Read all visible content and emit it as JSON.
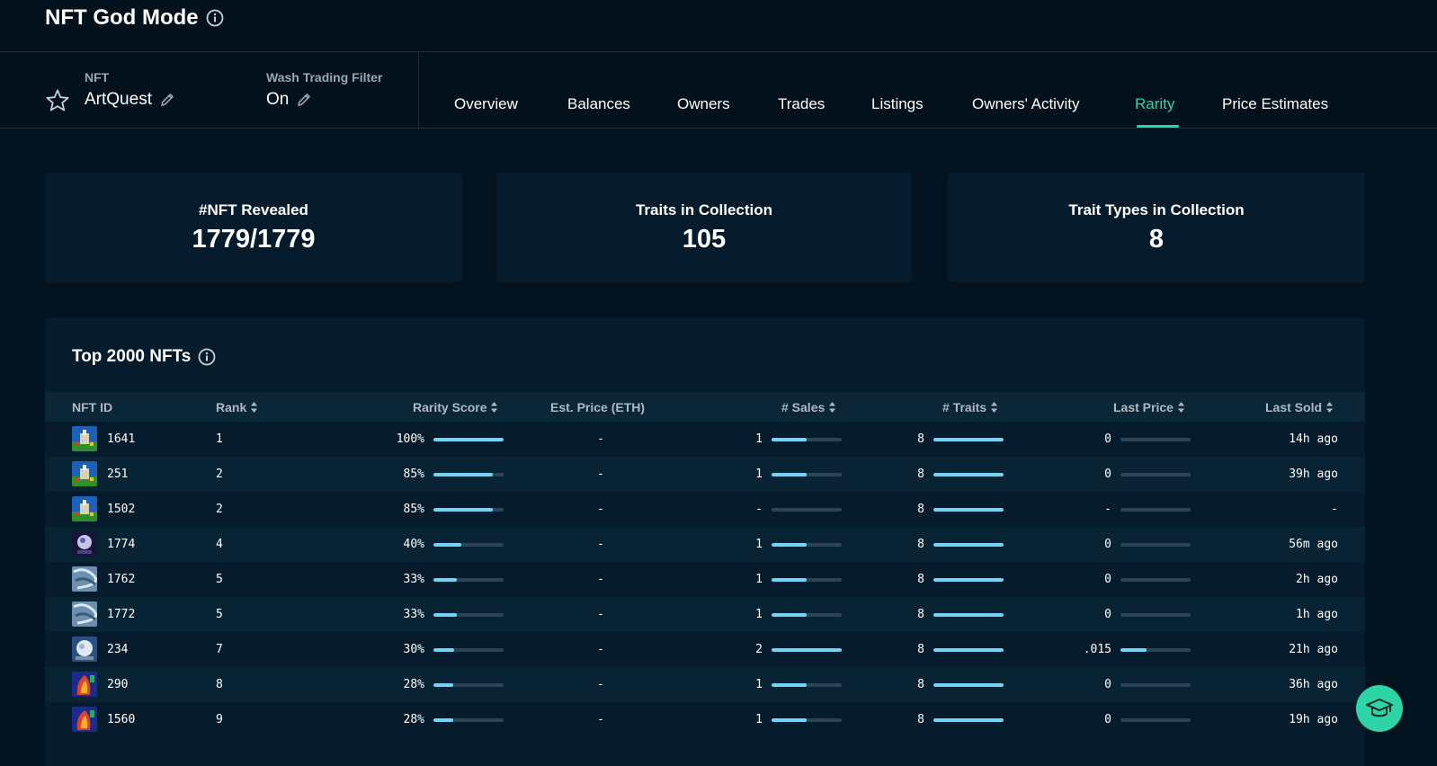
{
  "header": {
    "title": "NFT God Mode"
  },
  "filters": {
    "nft_label": "NFT",
    "nft_value": "ArtQuest",
    "wash_label": "Wash Trading Filter",
    "wash_value": "On"
  },
  "tabs": [
    {
      "label": "Overview"
    },
    {
      "label": "Balances"
    },
    {
      "label": "Owners"
    },
    {
      "label": "Trades"
    },
    {
      "label": "Listings"
    },
    {
      "label": "Owners' Activity"
    },
    {
      "label": "Rarity",
      "active": true
    },
    {
      "label": "Price Estimates"
    }
  ],
  "stats": [
    {
      "title": "#NFT Revealed",
      "value": "1779/1779"
    },
    {
      "title": "Traits in Collection",
      "value": "105"
    },
    {
      "title": "Trait Types in Collection",
      "value": "8"
    }
  ],
  "table": {
    "title": "Top 2000 NFTs",
    "columns": [
      "NFT ID",
      "Rank",
      "Rarity Score",
      "Est. Price (ETH)",
      "# Sales",
      "# Traits",
      "Last Price",
      "Last Sold"
    ],
    "rows": [
      {
        "id": "1641",
        "rank": "1",
        "rarity": "100%",
        "rarity_frac": 1.0,
        "est": "-",
        "sales": "1",
        "sales_frac": 0.5,
        "traits": "8",
        "traits_frac": 1.0,
        "last_price": "0",
        "price_frac": 0,
        "last_sold": "14h ago",
        "thumb": "castle"
      },
      {
        "id": "251",
        "rank": "2",
        "rarity": "85%",
        "rarity_frac": 0.85,
        "est": "-",
        "sales": "1",
        "sales_frac": 0.5,
        "traits": "8",
        "traits_frac": 1.0,
        "last_price": "0",
        "price_frac": 0,
        "last_sold": "39h ago",
        "thumb": "castle"
      },
      {
        "id": "1502",
        "rank": "2",
        "rarity": "85%",
        "rarity_frac": 0.85,
        "est": "-",
        "sales": "-",
        "sales_frac": 0,
        "traits": "8",
        "traits_frac": 1.0,
        "last_price": "-",
        "price_frac": 0,
        "last_sold": "-",
        "thumb": "castle"
      },
      {
        "id": "1774",
        "rank": "4",
        "rarity": "40%",
        "rarity_frac": 0.4,
        "est": "-",
        "sales": "1",
        "sales_frac": 0.5,
        "traits": "8",
        "traits_frac": 1.0,
        "last_price": "0",
        "price_frac": 0,
        "last_sold": "56m ago",
        "thumb": "orb"
      },
      {
        "id": "1762",
        "rank": "5",
        "rarity": "33%",
        "rarity_frac": 0.33,
        "est": "-",
        "sales": "1",
        "sales_frac": 0.5,
        "traits": "8",
        "traits_frac": 1.0,
        "last_price": "0",
        "price_frac": 0,
        "last_sold": "2h ago",
        "thumb": "swirl"
      },
      {
        "id": "1772",
        "rank": "5",
        "rarity": "33%",
        "rarity_frac": 0.33,
        "est": "-",
        "sales": "1",
        "sales_frac": 0.5,
        "traits": "8",
        "traits_frac": 1.0,
        "last_price": "0",
        "price_frac": 0,
        "last_sold": "1h ago",
        "thumb": "swirl"
      },
      {
        "id": "234",
        "rank": "7",
        "rarity": "30%",
        "rarity_frac": 0.3,
        "est": "-",
        "sales": "2",
        "sales_frac": 1.0,
        "traits": "8",
        "traits_frac": 1.0,
        "last_price": ".015",
        "price_frac": 0.37,
        "last_sold": "21h ago",
        "thumb": "moon"
      },
      {
        "id": "290",
        "rank": "8",
        "rarity": "28%",
        "rarity_frac": 0.28,
        "est": "-",
        "sales": "1",
        "sales_frac": 0.5,
        "traits": "8",
        "traits_frac": 1.0,
        "last_price": "0",
        "price_frac": 0,
        "last_sold": "36h ago",
        "thumb": "fire"
      },
      {
        "id": "1560",
        "rank": "9",
        "rarity": "28%",
        "rarity_frac": 0.28,
        "est": "-",
        "sales": "1",
        "sales_frac": 0.5,
        "traits": "8",
        "traits_frac": 1.0,
        "last_price": "0",
        "price_frac": 0,
        "last_sold": "19h ago",
        "thumb": "fire"
      }
    ]
  },
  "colors": {
    "accent": "#2ed3a6",
    "bar_fill": "#74d4f6",
    "bar_track": "#2c4556",
    "background": "#03131f",
    "card": "#061c2c"
  },
  "icons": {
    "title_info": "info-circle-icon",
    "favorite": "star-outline-icon",
    "edit": "pencil-icon",
    "sort": "sort-arrows-icon",
    "help": "graduation-cap-icon"
  }
}
